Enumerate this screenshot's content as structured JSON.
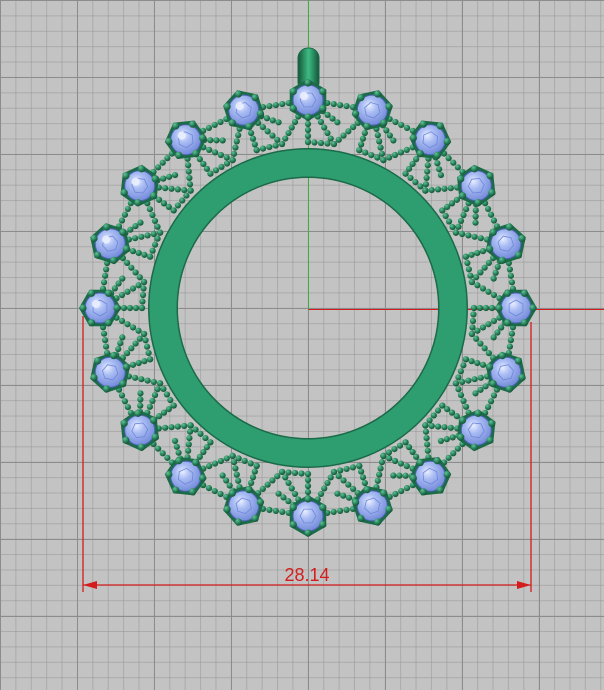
{
  "viewport": {
    "name": "front-viewport"
  },
  "model": {
    "name": "pendant",
    "stone_count": 20,
    "colors": {
      "metal": "#2e9e70",
      "metal_dark": "#1b6a48",
      "bead": "#237a55",
      "stone": "#8fa6ec",
      "stone_highlight": "#e8eeff",
      "background": "#c3c3c3",
      "grid_major": "#8c8c8c",
      "axis_green": "#3fae3f",
      "axis_red": "#d41c1c"
    }
  },
  "dimension": {
    "value": "28.14",
    "color": "#d41c1c"
  }
}
